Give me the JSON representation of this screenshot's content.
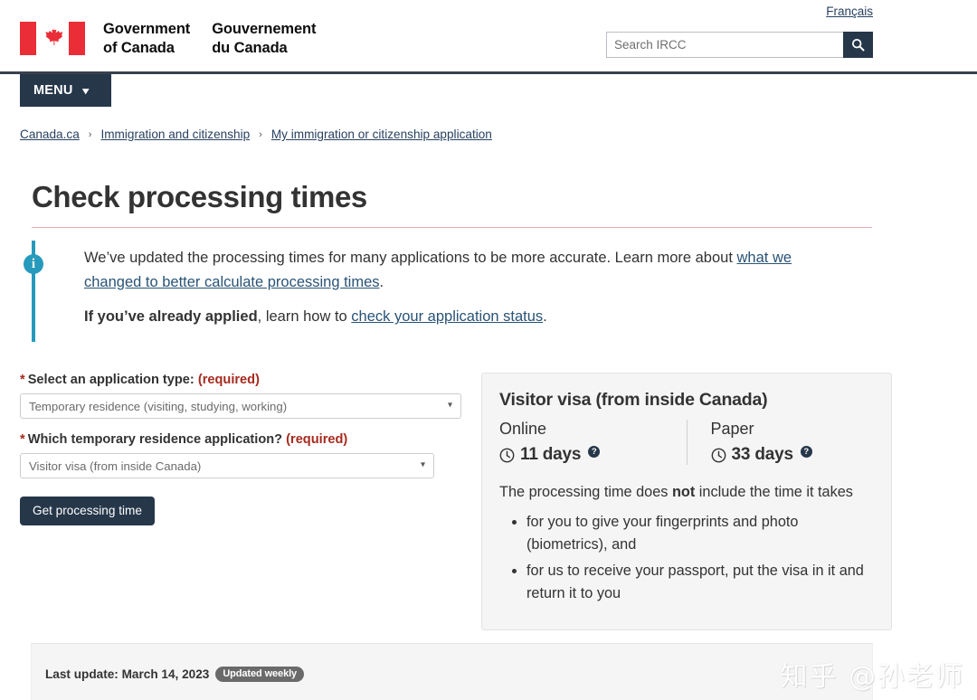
{
  "header": {
    "brand_en": "Government\nof Canada",
    "brand_fr": "Gouvernement\ndu Canada",
    "flag_icon": "canada-flag-icon",
    "language_toggle": "Français",
    "search_placeholder": "Search IRCC",
    "search_value": "",
    "search_icon": "search-icon",
    "menu_label": "MENU",
    "menu_caret_icon": "chevron-down-icon"
  },
  "breadcrumb": {
    "separator": "›",
    "items": [
      {
        "label": "Canada.ca"
      },
      {
        "label": "Immigration and citizenship"
      },
      {
        "label": "My immigration or citizenship application"
      }
    ]
  },
  "page": {
    "title": "Check processing times"
  },
  "alert": {
    "icon": "info-circle-icon",
    "icon_glyph": "i",
    "paragraph1_pre": "We’ve updated the processing times for many applications to be more accurate. Learn more about ",
    "paragraph1_link": "what we changed to better calculate processing times",
    "paragraph1_post": ".",
    "paragraph2_bold": "If you’ve already applied",
    "paragraph2_mid": ", learn how to ",
    "paragraph2_link": "check your application status",
    "paragraph2_post": "."
  },
  "form": {
    "field1": {
      "star": "*",
      "label": "Select an application type:",
      "required": "(required)",
      "value": "Temporary residence (visiting, studying, working)",
      "arrow_icon": "chevron-down-icon"
    },
    "field2": {
      "star": "*",
      "label": "Which temporary residence application?",
      "required": "(required)",
      "value": "Visitor visa (from inside Canada)",
      "arrow_icon": "chevron-down-icon"
    },
    "submit_label": "Get processing time"
  },
  "result": {
    "title": "Visitor visa (from inside Canada)",
    "online": {
      "mode": "Online",
      "clock_icon": "clock-icon",
      "value": "11 days",
      "help_icon": "help-circle-icon",
      "help_glyph": "?"
    },
    "paper": {
      "mode": "Paper",
      "clock_icon": "clock-icon",
      "value": "33 days",
      "help_icon": "help-circle-icon",
      "help_glyph": "?"
    },
    "note_pre": "The processing time does ",
    "note_bold": "not",
    "note_post": " include the time it takes",
    "bullets": [
      "for you to give your fingerprints and photo (biometrics), and",
      "for us to receive your passport, put the visa in it and return it to you"
    ]
  },
  "footer": {
    "last_update_label": "Last update: March 14, 2023",
    "updated_badge": "Updated weekly"
  },
  "watermark": {
    "text": "知乎 @孙老师"
  },
  "colors": {
    "brand_dark": "#26374a",
    "link": "#284162",
    "required_red": "#a62a1e",
    "alert_accent": "#269abc",
    "title_rule": "#dfb1ae",
    "panel_bg": "#f5f5f5",
    "badge_gray": "#6a6a6a",
    "flag_red": "#ea2d37"
  }
}
